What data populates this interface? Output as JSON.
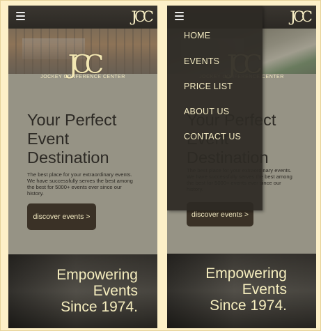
{
  "brand": {
    "logo_mark": "JCC",
    "full_name": "JOCKEY CONFERENCE CENTER"
  },
  "hero": {
    "headline_line1": "Your Perfect",
    "headline_line2": "Event",
    "headline_line3": "Destination",
    "description": "The best place for your extraordinary events. We have successfully serves the best among the best for 5000+ events ever since our history.",
    "cta_label": "discover events >"
  },
  "band": {
    "line1": "Empowering",
    "line2": "Events",
    "line3": "Since 1974."
  },
  "nav_menu": {
    "items": [
      "HOME",
      "EVENTS",
      "PRICE LIST",
      "ABOUT US",
      "CONTACT US"
    ]
  },
  "colors": {
    "page_background": "#fdf0c8",
    "accent_cream": "#f5ecc3",
    "dark_brown": "#3a3126",
    "menu_background": "#2d2a25"
  },
  "icons": {
    "menu": "hamburger-menu-icon"
  }
}
